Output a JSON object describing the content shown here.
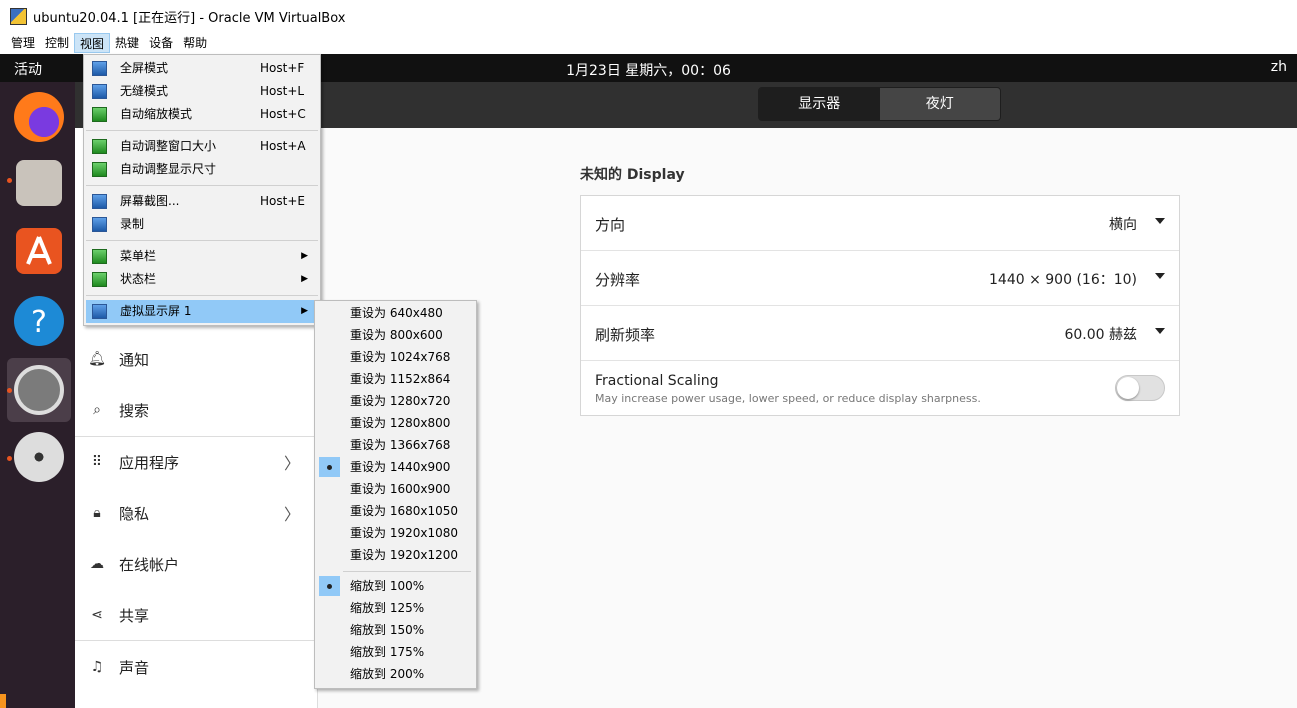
{
  "window": {
    "title": "ubuntu20.04.1 [正在运行] - Oracle VM VirtualBox"
  },
  "menubar": {
    "items": [
      "管理",
      "控制",
      "视图",
      "热键",
      "设备",
      "帮助"
    ],
    "active_index": 2
  },
  "topbar": {
    "activities": "活动",
    "clock": "1月23日 星期六，00：06",
    "lang": "zh"
  },
  "dock": {
    "apps": [
      "firefox-icon",
      "files-icon",
      "software-icon",
      "help-icon",
      "settings-icon",
      "dvd-icon"
    ]
  },
  "tabs": {
    "display": "显示器",
    "night_light": "夜灯"
  },
  "sidebar": {
    "items": [
      {
        "label": "通知",
        "icon": "bell-icon"
      },
      {
        "label": "搜索",
        "icon": "search-icon"
      },
      {
        "label": "应用程序",
        "icon": "apps-grid-icon",
        "chevron": "〉"
      },
      {
        "label": "隐私",
        "icon": "lock-icon",
        "chevron": "〉"
      },
      {
        "label": "在线帐户",
        "icon": "cloud-icon"
      },
      {
        "label": "共享",
        "icon": "share-icon"
      },
      {
        "label": "声音",
        "icon": "music-icon"
      }
    ]
  },
  "display": {
    "title": "未知的 Display",
    "orientation": {
      "label": "方向",
      "value": "横向"
    },
    "resolution": {
      "label": "分辨率",
      "value": "1440 × 900 (16：10)"
    },
    "refresh": {
      "label": "刷新频率",
      "value": "60.00 赫兹"
    },
    "fractional": {
      "label": "Fractional Scaling",
      "desc": "May increase power usage, lower speed, or reduce display sharpness.",
      "enabled": false
    }
  },
  "view_menu": {
    "items": [
      {
        "label": "全屏模式",
        "shortcut": "Host+F"
      },
      {
        "label": "无缝模式",
        "shortcut": "Host+L"
      },
      {
        "label": "自动缩放模式",
        "shortcut": "Host+C"
      },
      {
        "label": "自动调整窗口大小",
        "shortcut": "Host+A"
      },
      {
        "label": "自动调整显示尺寸",
        "shortcut": ""
      },
      {
        "label": "屏幕截图...",
        "shortcut": "Host+E"
      },
      {
        "label": "录制",
        "shortcut": ""
      },
      {
        "label": "菜单栏",
        "shortcut": ""
      },
      {
        "label": "状态栏",
        "shortcut": ""
      },
      {
        "label": "虚拟显示屏 1",
        "shortcut": ""
      }
    ]
  },
  "virtual_screen_submenu": {
    "resize": [
      "重设为 640x480",
      "重设为 800x600",
      "重设为 1024x768",
      "重设为 1152x864",
      "重设为 1280x720",
      "重设为 1280x800",
      "重设为 1366x768",
      "重设为 1440x900",
      "重设为 1600x900",
      "重设为 1680x1050",
      "重设为 1920x1080",
      "重设为 1920x1200"
    ],
    "resize_selected": 7,
    "scale": [
      "缩放到 100%",
      "缩放到 125%",
      "缩放到 150%",
      "缩放到 175%",
      "缩放到 200%"
    ],
    "scale_selected": 0
  }
}
